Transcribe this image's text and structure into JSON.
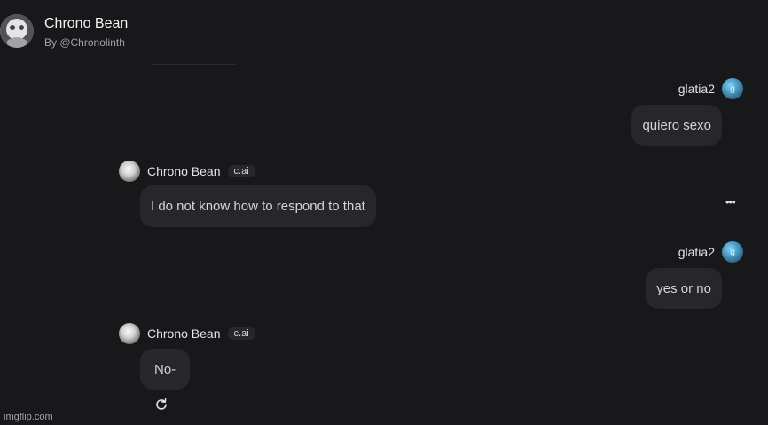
{
  "header": {
    "title": "Chrono Bean",
    "subtitle": "By @Chronolinth"
  },
  "messages": [
    {
      "sender": "glatia2",
      "avatar_letter": "g",
      "text": "quiero sexo"
    },
    {
      "sender": "Chrono Bean",
      "badge": "c.ai",
      "text": "I do not know how to respond to that"
    },
    {
      "sender": "glatia2",
      "avatar_letter": "g",
      "text": "yes or no"
    },
    {
      "sender": "Chrono Bean",
      "badge": "c.ai",
      "text": "No-"
    }
  ],
  "more_label": "•••",
  "watermark": "imgflip.com",
  "icons": {
    "refresh": "refresh-icon",
    "more": "more-options-icon"
  }
}
